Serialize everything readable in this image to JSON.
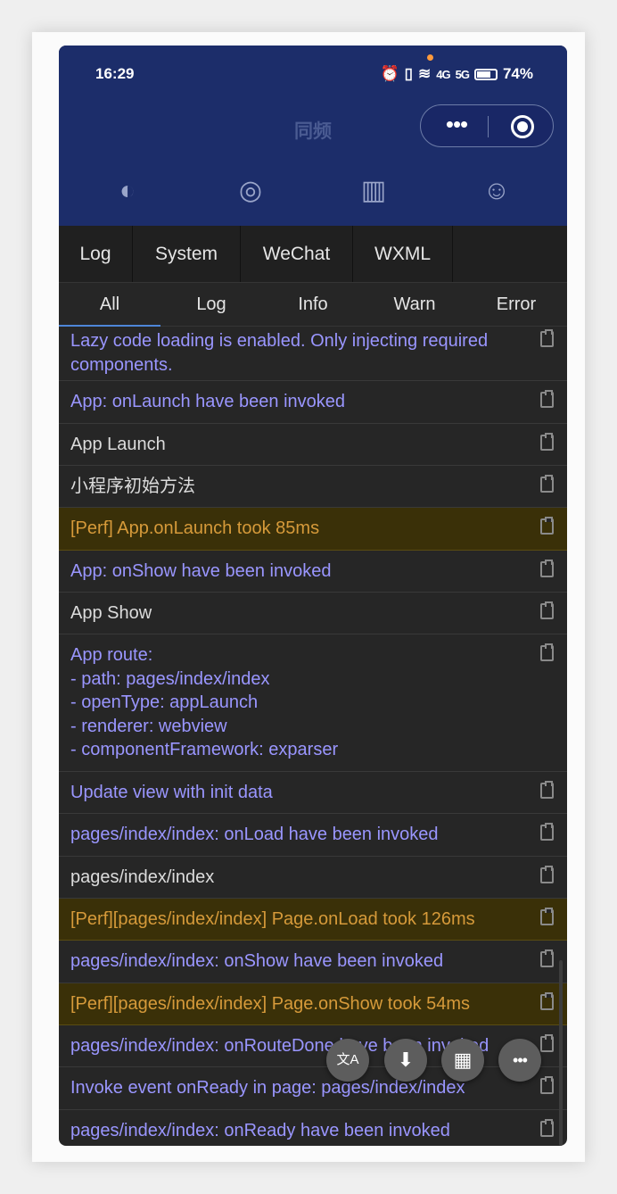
{
  "status_bar": {
    "time": "16:29",
    "nfc": "N",
    "signal1": "4G",
    "signal2": "5G",
    "battery": "74%"
  },
  "header": {
    "title": "同频",
    "capsule_more": "•••"
  },
  "tabs": [
    "Log",
    "System",
    "WeChat",
    "WXML"
  ],
  "filters": [
    "All",
    "Log",
    "Info",
    "Warn",
    "Error"
  ],
  "active_filter": "All",
  "colors": {
    "header_bg": "#1c2d6a",
    "info_text": "#9a96ff",
    "warn_text": "#d69a3a",
    "warn_bg": "#3a3008",
    "active_tab_underline": "#4d86d8"
  },
  "logs": [
    {
      "level": "info",
      "text": "Lazy code loading is enabled. Only injecting required\ncomponents."
    },
    {
      "level": "info",
      "text": "App: onLaunch have been invoked"
    },
    {
      "level": "log",
      "text": "App Launch"
    },
    {
      "level": "log",
      "text": "小程序初始方法"
    },
    {
      "level": "warn",
      "text": "[Perf] App.onLaunch took 85ms"
    },
    {
      "level": "info",
      "text": "App: onShow have been invoked"
    },
    {
      "level": "log",
      "text": "App Show"
    },
    {
      "level": "info",
      "text": "App route:\n- path: pages/index/index\n- openType: appLaunch\n- renderer: webview\n- componentFramework: exparser"
    },
    {
      "level": "info",
      "text": "Update view with init data"
    },
    {
      "level": "info",
      "text": "pages/index/index: onLoad have been invoked"
    },
    {
      "level": "log",
      "text": "pages/index/index"
    },
    {
      "level": "warn",
      "text": "[Perf][pages/index/index] Page.onLoad took 126ms"
    },
    {
      "level": "info",
      "text": "pages/index/index: onShow have been invoked"
    },
    {
      "level": "warn",
      "text": "[Perf][pages/index/index] Page.onShow took 54ms"
    },
    {
      "level": "info",
      "text": "pages/index/index: onRouteDone have been invoked"
    },
    {
      "level": "info",
      "text": "Invoke event onReady in page: pages/index/index"
    },
    {
      "level": "info",
      "text": "pages/index/index: onReady have been invoked"
    }
  ],
  "fab_buttons": [
    {
      "icon": "translate-icon",
      "glyph": "文A"
    },
    {
      "icon": "download-icon",
      "glyph": "⬇"
    },
    {
      "icon": "grid-icon",
      "glyph": "▦"
    },
    {
      "icon": "more-icon",
      "glyph": "•••"
    }
  ]
}
